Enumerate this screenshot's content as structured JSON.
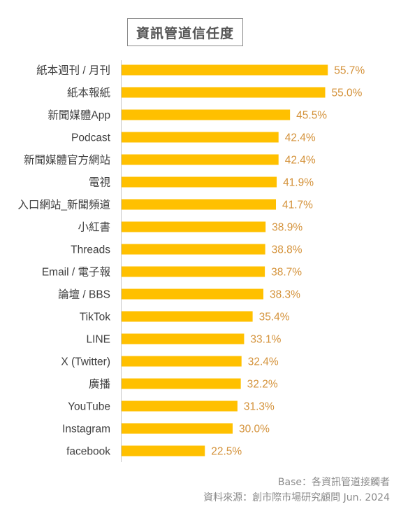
{
  "chart_data": {
    "type": "bar",
    "orientation": "horizontal",
    "title": "資訊管道信任度",
    "xlabel": "",
    "ylabel": "",
    "unit": "%",
    "xlim": [
      0,
      60
    ],
    "grid": false,
    "bar_color": "#ffc000",
    "value_label_color": "#d4923a",
    "categories": [
      "紙本週刊 / 月刊",
      "紙本報紙",
      "新聞媒體App",
      "Podcast",
      "新聞媒體官方網站",
      "電視",
      "入口網站_新聞頻道",
      "小紅書",
      "Threads",
      "Email / 電子報",
      "論壇 / BBS",
      "TikTok",
      "LINE",
      "X (Twitter)",
      "廣播",
      "YouTube",
      "Instagram",
      "facebook"
    ],
    "values": [
      55.7,
      55.0,
      45.5,
      42.4,
      42.4,
      41.9,
      41.7,
      38.9,
      38.8,
      38.7,
      38.3,
      35.4,
      33.1,
      32.4,
      32.2,
      31.3,
      30.0,
      22.5
    ],
    "value_labels": [
      "55.7%",
      "55.0%",
      "45.5%",
      "42.4%",
      "42.4%",
      "41.9%",
      "41.7%",
      "38.9%",
      "38.8%",
      "38.7%",
      "38.3%",
      "35.4%",
      "33.1%",
      "32.4%",
      "32.2%",
      "31.3%",
      "30.0%",
      "22.5%"
    ]
  },
  "footer": {
    "base": "Base：各資訊管道接觸者",
    "source": "資料來源：創市際市場研究顧問 Jun. 2024"
  }
}
